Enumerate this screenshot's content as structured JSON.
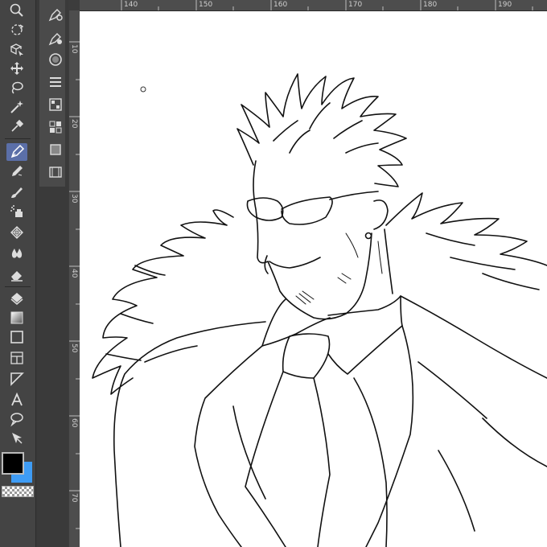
{
  "ruler": {
    "top_labels": [
      "140",
      "150",
      "160",
      "170",
      "180",
      "190"
    ],
    "left_labels": [
      "10",
      "20",
      "30",
      "40",
      "50",
      "60",
      "70"
    ]
  },
  "tools": [
    {
      "name": "zoom-icon"
    },
    {
      "name": "rotate-icon"
    },
    {
      "name": "move-layer-icon"
    },
    {
      "name": "move-icon"
    },
    {
      "name": "lasso-icon"
    },
    {
      "name": "magic-wand-icon"
    },
    {
      "name": "eyedropper-icon"
    },
    {
      "name": "pen-icon",
      "active": true
    },
    {
      "name": "pencil-icon"
    },
    {
      "name": "brush-icon"
    },
    {
      "name": "airbrush-icon"
    },
    {
      "name": "decoration-icon"
    },
    {
      "name": "blend-icon"
    },
    {
      "name": "eraser-icon"
    },
    {
      "name": "fill-icon"
    },
    {
      "name": "gradient-icon"
    },
    {
      "name": "figure-icon"
    },
    {
      "name": "frame-border-icon"
    },
    {
      "name": "ruler-tool-icon"
    },
    {
      "name": "text-icon"
    },
    {
      "name": "balloon-icon"
    },
    {
      "name": "object-select-icon"
    }
  ],
  "colors": {
    "main": "#000000",
    "sub": "#3e9cf5",
    "active_tool_bg": "#5b6fa8"
  }
}
